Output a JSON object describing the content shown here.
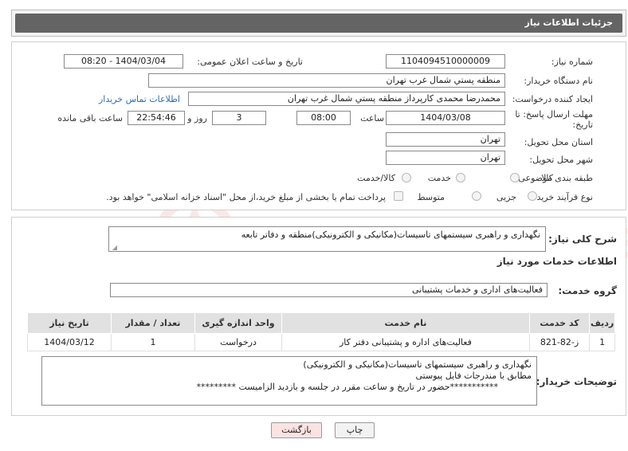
{
  "header": {
    "title": "جزئیات اطلاعات نیاز"
  },
  "form": {
    "need_number_label": "شماره نیاز:",
    "need_number": "1104094510000009",
    "announce_label": "تاریخ و ساعت اعلان عمومی:",
    "announce_value": "1404/03/04 - 08:20",
    "buyer_org_label": "نام دستگاه خریدار:",
    "buyer_org": "منطقه پستي شمال غرب تهران",
    "creator_label": "ایجاد کننده درخواست:",
    "creator": "محمدرضا  محمدی کارپرداز منطقه پستي شمال غرب تهران",
    "contact_link": "اطلاعات تماس خریدار",
    "deadline_label_1": "مهلت ارسال پاسخ: تا",
    "deadline_label_2": "تاریخ:",
    "deadline_date": "1404/03/08",
    "time_label": "ساعت",
    "deadline_time": "08:00",
    "days_value": "3",
    "days_label": "روز و",
    "remaining_time": "22:54:46",
    "remaining_label": "ساعت باقی مانده",
    "province_label": "استان محل تحویل:",
    "province": "تهران",
    "city_label": "شهر محل تحویل:",
    "city": "تهران",
    "category_label": "طبقه بندی موضوعی:",
    "category_options": [
      "کالا",
      "خدمت",
      "کالا/خدمت"
    ],
    "process_label": "نوع فرآیند خرید :",
    "process_options": [
      "جزیی",
      "متوسط"
    ],
    "payment_note": "پرداخت تمام یا بخشی از مبلغ خرید،از محل \"اسناد خزانه اسلامی\" خواهد بود."
  },
  "details": {
    "summary_label": "شرح کلی نیاز:",
    "summary": "نگهداری و راهبری سیستمهای تاسیسات(مکانیکی و الکترونیکی)منطقه و دفاتر تابعه",
    "services_title": "اطلاعات خدمات مورد نیاز",
    "service_group_label": "گروه خدمت:",
    "service_group": "فعالیت‌های اداری و خدمات پشتیبانی",
    "table": {
      "headers": [
        "ردیف",
        "کد خدمت",
        "نام خدمت",
        "واحد اندازه گیری",
        "تعداد / مقدار",
        "تاریخ نیاز"
      ],
      "rows": [
        [
          "1",
          "ز-82-821",
          "فعالیت‌های اداره و پشتیبانی دفتر کار",
          "درخواست",
          "1",
          "1404/03/12"
        ]
      ]
    },
    "buyer_notes_label": "توضیحات خریدار:",
    "buyer_notes_line1": "نگهداری و راهبری سیستمهای تاسیسات(مکانیکی و الکترونیکی)",
    "buyer_notes_line2": "مطابق با مندرجات فایل پیوستی",
    "buyer_notes_line3": "***********حضور در تاریخ و ساعت مقرر در جلسه و بازدید الزامیست *********"
  },
  "buttons": {
    "print": "چاپ",
    "back": "بازگشت"
  },
  "watermark": "AriaTender.neT",
  "colors": {
    "header_bg": "#646464",
    "link": "#2a6fb4",
    "back_btn_bg": "#fde2e2"
  }
}
